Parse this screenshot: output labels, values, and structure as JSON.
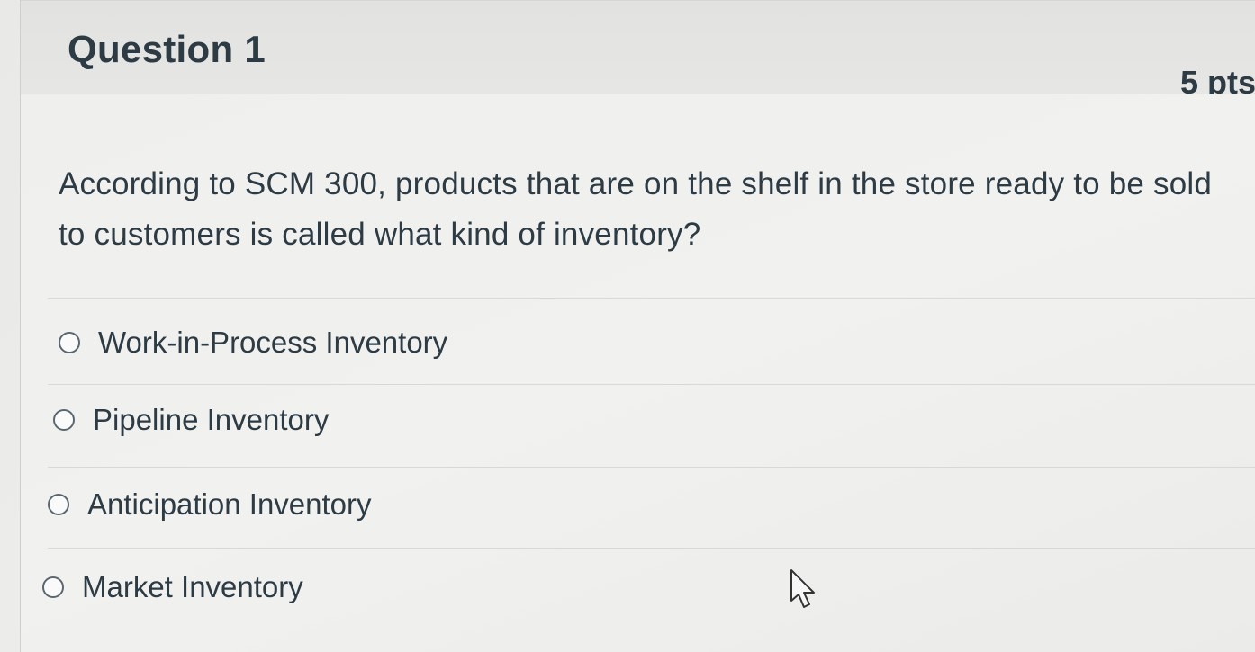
{
  "question": {
    "title": "Question 1",
    "points": "5 pts",
    "text": "According to SCM 300, products that are on the shelf in the store ready to be sold to customers is called what kind of inventory?"
  },
  "answers": [
    {
      "label": "Work-in-Process Inventory",
      "selected": false
    },
    {
      "label": "Pipeline Inventory",
      "selected": false
    },
    {
      "label": "Anticipation Inventory",
      "selected": false
    },
    {
      "label": "Market Inventory",
      "selected": false
    }
  ],
  "icons": {
    "radio": "radio-unchecked-icon",
    "cursor": "mouse-pointer-icon"
  }
}
